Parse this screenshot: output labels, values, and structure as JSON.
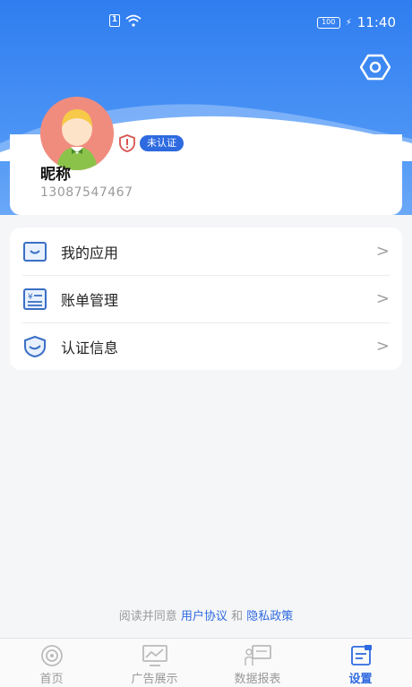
{
  "status_bar": {
    "sim_label": "1",
    "battery": "100",
    "time": "11:40"
  },
  "profile": {
    "nickname": "昵称",
    "phone": "13087547467",
    "verify_badge": "未认证"
  },
  "menu": {
    "items": [
      {
        "label": "我的应用",
        "icon": "app-box-icon"
      },
      {
        "label": "账单管理",
        "icon": "bill-icon"
      },
      {
        "label": "认证信息",
        "icon": "shield-check-icon"
      }
    ],
    "chevron": ">"
  },
  "agreement": {
    "prefix": "阅读并同意",
    "user_agreement": "用户协议",
    "and": "和",
    "privacy_policy": "隐私政策"
  },
  "bottom_nav": {
    "items": [
      {
        "label": "首页",
        "icon": "home-target-icon"
      },
      {
        "label": "广告展示",
        "icon": "ad-display-icon"
      },
      {
        "label": "数据报表",
        "icon": "report-icon"
      },
      {
        "label": "设置",
        "icon": "settings-icon"
      }
    ],
    "active_index": 3
  },
  "colors": {
    "accent": "#2e6ae0",
    "header": "#3b86f2",
    "avatar_bg": "#f08c7e"
  }
}
